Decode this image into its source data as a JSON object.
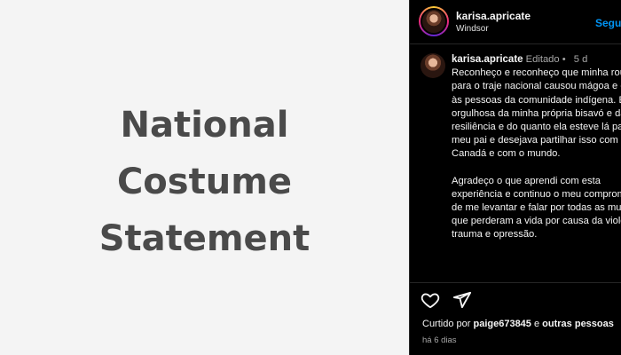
{
  "post_image": {
    "lines": [
      "National",
      "Costume",
      "Statement"
    ]
  },
  "header": {
    "username": "karisa.apricate",
    "location": "Windsor",
    "follow_label": "Seguir"
  },
  "caption": {
    "username": "karisa.apricate",
    "edited_label": "Editado",
    "separator": "•",
    "time": "5 d",
    "paragraph1": "Reconheço e reconheço que minha roupa para o traje nacional causou mágoa e ofensa às pessoas da comunidade indígena. Estou orgulhosa da minha própria bisavó e da sua resiliência e do quanto ela esteve lá para o meu pai e desejava partilhar isso com o Canadá e com o mundo.",
    "paragraph2": "Agradeço o que aprendi com esta experiência e continuo o meu compromisso de me levantar e falar por todas as mulheres que perderam a vida por causa da violência, trauma e opressão."
  },
  "actions": {
    "like_icon": "heart-icon",
    "share_icon": "send-icon",
    "liked_by_prefix": "Curtido por",
    "liked_by_user": "paige673845",
    "liked_by_conj": "e",
    "liked_by_others": "outras pessoas",
    "posted_ago": "há 6 dias"
  }
}
